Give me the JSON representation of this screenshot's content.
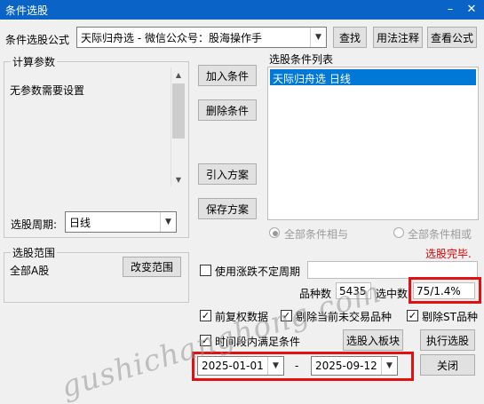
{
  "window": {
    "title": "条件选股"
  },
  "header": {
    "formula_label": "条件选股公式",
    "formula_value": "天际归舟选  -  微信公众号：股海操作手",
    "find_btn": "查找",
    "usage_btn": "用法注释",
    "view_btn": "查看公式"
  },
  "params": {
    "legend": "计算参数",
    "text": "无参数需要设置"
  },
  "period": {
    "label": "选股周期:",
    "value": "日线"
  },
  "actions": {
    "add": "加入条件",
    "delete": "删除条件",
    "import": "引入方案",
    "save": "保存方案"
  },
  "conditions": {
    "label": "选股条件列表",
    "items": [
      "天际归舟选  日线"
    ]
  },
  "logic": {
    "and_label": "全部条件相与",
    "or_label": "全部条件相或"
  },
  "status": "选股完毕.",
  "range": {
    "legend": "选股范围",
    "value": "全部A股",
    "change_btn": "改变范围"
  },
  "variable_period": {
    "label": "使用涨跌不定周期"
  },
  "counts": {
    "total_label": "品种数",
    "total_value": "5435",
    "selected_label": "选中数",
    "selected_value": "75/1.4%"
  },
  "options": {
    "fuquan": "前复权数据",
    "exclude_notrade": "剔除当前未交易品种",
    "exclude_st": "剔除ST品种",
    "time_range": "时间段内满足条件"
  },
  "buttons": {
    "to_block": "选股入板块",
    "execute": "执行选股",
    "close": "关闭"
  },
  "dates": {
    "start": "2025-01-01",
    "sep": "-",
    "end": "2025-09-12"
  },
  "watermark": "gushichanghong.com",
  "colors": {
    "title_bar": "#0a64c8",
    "selection": "#0078d7",
    "status": "#e00000",
    "highlight": "#e21010"
  }
}
